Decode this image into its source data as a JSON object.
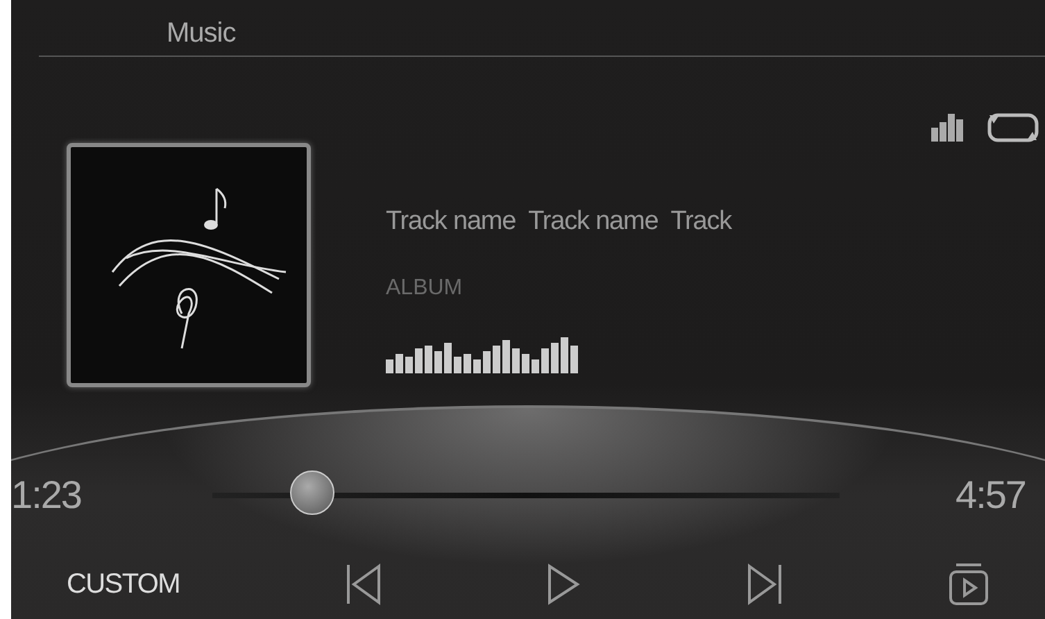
{
  "header": {
    "title": "Music"
  },
  "track": {
    "name": "Track name  Track name  Track",
    "album": "ALBUM"
  },
  "progress": {
    "elapsed": "1:23",
    "total": "4:57",
    "level": 0.16
  },
  "controls": {
    "mode": "CUSTOM"
  }
}
